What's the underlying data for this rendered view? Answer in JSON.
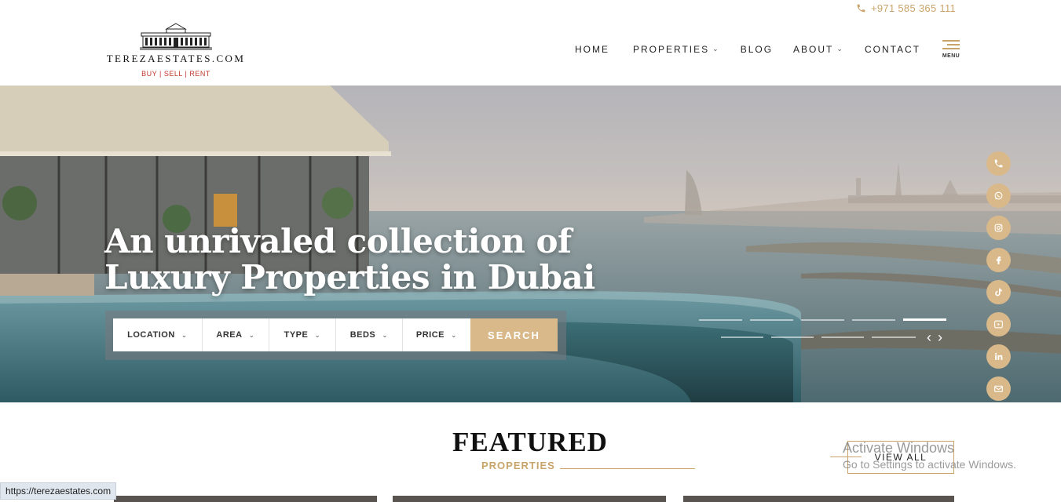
{
  "header": {
    "phone": "+971 585 365 111",
    "logo": {
      "name": "TEREZAESTATES.COM",
      "tagline": "BUY | SELL | RENT"
    },
    "nav": [
      {
        "label": "HOME",
        "dropdown": false
      },
      {
        "label": "PROPERTIES",
        "dropdown": true
      },
      {
        "label": "BLOG",
        "dropdown": false
      },
      {
        "label": "ABOUT",
        "dropdown": true
      },
      {
        "label": "CONTACT",
        "dropdown": false
      }
    ],
    "menu_label": "MENU"
  },
  "hero": {
    "title_line1": "An unrivaled collection of",
    "title_line2": "Luxury Properties in Dubai",
    "search": {
      "fields": [
        "LOCATION",
        "AREA",
        "TYPE",
        "BEDS",
        "PRICE"
      ],
      "button": "SEARCH"
    },
    "slider": {
      "total_slides": 9,
      "active_slide": 5
    }
  },
  "social": [
    "phone-icon",
    "whatsapp-icon",
    "instagram-icon",
    "facebook-icon",
    "tiktok-icon",
    "youtube-icon",
    "linkedin-icon",
    "email-icon"
  ],
  "featured": {
    "title": "FEATURED",
    "subtitle": "PROPERTIES",
    "view_all": "VIEW ALL"
  },
  "watermark": {
    "line1": "Activate Windows",
    "line2": "Go to Settings to activate Windows."
  },
  "status_url": "https://terezaestates.com",
  "colors": {
    "gold": "#c9a46a",
    "gold_light": "#d9b98a",
    "tagline_red": "#c0392b"
  }
}
